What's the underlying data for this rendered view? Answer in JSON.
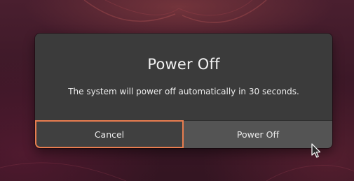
{
  "dialog": {
    "title": "Power Off",
    "message": "The system will power off automatically in 30 seconds.",
    "buttons": {
      "cancel_label": "Cancel",
      "power_off_label": "Power Off"
    },
    "focused_button": "Cancel",
    "accent_color": "#e97d4f"
  },
  "pointer": {
    "icon": "arrow-cursor-icon"
  }
}
